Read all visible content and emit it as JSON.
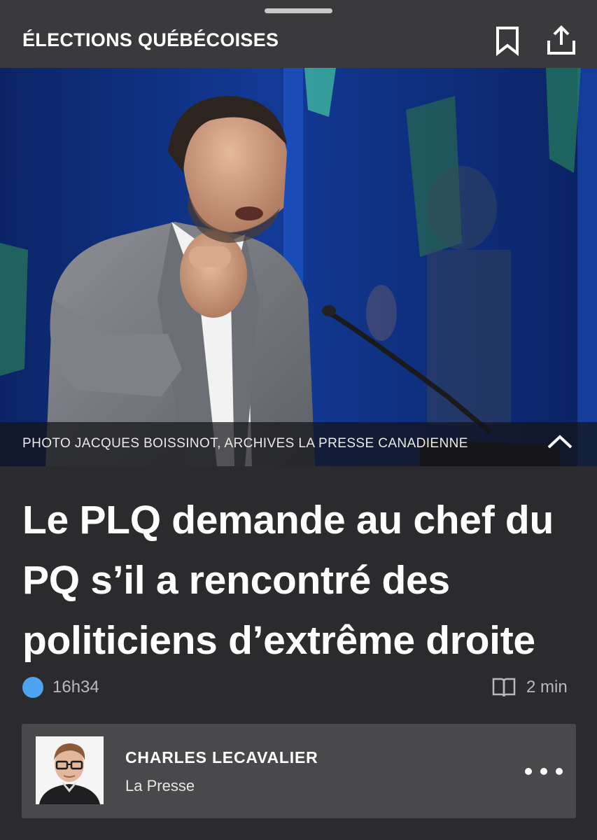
{
  "header": {
    "section": "ÉLECTIONS QUÉBÉCOISES",
    "bookmark_icon": "bookmark-icon",
    "share_icon": "share-icon"
  },
  "photo": {
    "caption": "PHOTO JACQUES BOISSINOT, ARCHIVES LA PRESSE CANADIENNE",
    "collapse_icon": "chevron-up-icon"
  },
  "article": {
    "headline_lines": [
      "Le PLQ demande au chef du",
      "PQ s’il a rencontré des",
      "politiciens d’extrême droite"
    ],
    "time": "16h34",
    "read_time": "2 min",
    "status_color": "#4da3ef"
  },
  "author": {
    "name": "CHARLES LECAVALIER",
    "outlet": "La Presse",
    "more_icon": "more-horizontal-icon"
  },
  "colors": {
    "background": "#2b2b2d",
    "header_bg": "#3a3a3c",
    "card_bg": "#49494b"
  }
}
